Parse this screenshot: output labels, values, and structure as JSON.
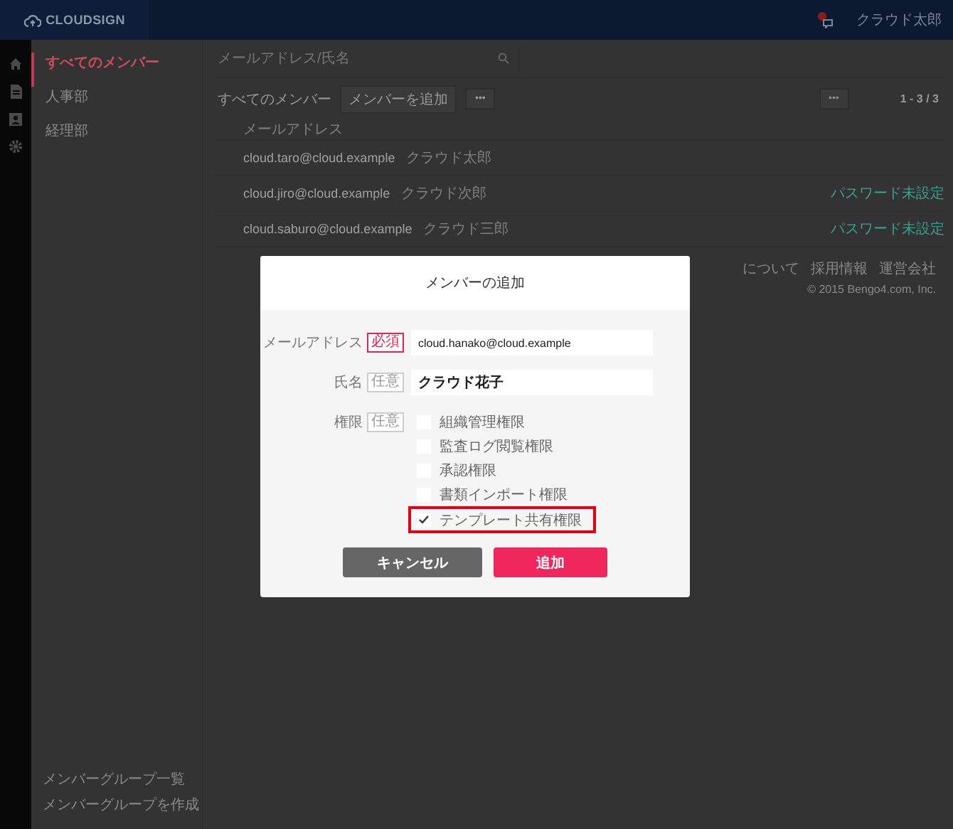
{
  "header": {
    "logo": "CLOUDSIGN",
    "user": "クラウド太郎"
  },
  "groups": [
    {
      "label": "すべてのメンバー",
      "selected": true
    },
    {
      "label": "人事部",
      "selected": false
    },
    {
      "label": "経理部",
      "selected": false
    }
  ],
  "group_actions": [
    "メンバーグループ一覧",
    "メンバーグループを作成"
  ],
  "search": {
    "placeholder": "メールアドレス/氏名"
  },
  "toolbar": {
    "title": "すべてのメンバー",
    "add_button": "メンバーを追加",
    "more_button": "•••",
    "right_more_button": "•••",
    "pagination": "1 - 3 / 3"
  },
  "table": {
    "columns": [
      "メールアドレス"
    ],
    "rows": [
      {
        "email": "cloud.taro@cloud.example",
        "name": "クラウド太郎",
        "status": ""
      },
      {
        "email": "cloud.jiro@cloud.example",
        "name": "クラウド次郎",
        "status": "パスワード未設定"
      },
      {
        "email": "cloud.saburo@cloud.example",
        "name": "クラウド三郎",
        "status": "パスワード未設定"
      }
    ]
  },
  "footer": [
    "について",
    "採用情報",
    "運営会社",
    "© 2015 Bengo4.com, Inc."
  ],
  "dialog": {
    "title": "メンバーの追加",
    "fields": [
      {
        "label": "メールアドレス",
        "badge": "必須",
        "kind": "required",
        "value": "cloud.hanako@cloud.example"
      },
      {
        "label": "氏名",
        "badge": "任意",
        "kind": "optional",
        "value": "クラウド花子"
      }
    ],
    "permissions": {
      "label": "権限",
      "badge": "任意",
      "items": [
        {
          "label": "組織管理権限",
          "checked": false,
          "highlighted": false
        },
        {
          "label": "監査ログ閲覧権限",
          "checked": false,
          "highlighted": false
        },
        {
          "label": "承認権限",
          "checked": false,
          "highlighted": false
        },
        {
          "label": "書類インポート権限",
          "checked": false,
          "highlighted": false
        },
        {
          "label": "テンプレート共有権限",
          "checked": true,
          "highlighted": true
        }
      ]
    },
    "cancel_button": "キャンセル",
    "submit_button": "追加"
  }
}
